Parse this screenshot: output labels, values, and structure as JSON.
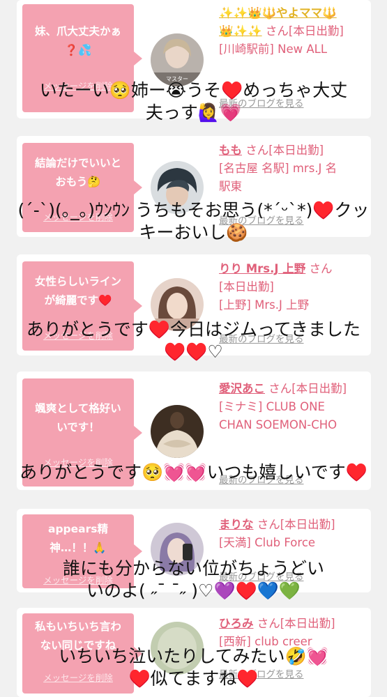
{
  "cards": [
    {
      "bubble_text": "妹、爪大丈夫かぁ\n❓💦",
      "delete_label": "メッセージを削除",
      "name": "✨✨👑🔱やよママ🔱\n👑✨✨",
      "san_text": "さん[本日出勤]",
      "location": "[川崎駅前] New ALL",
      "blog_link": "最新のブログを見る",
      "avatar_caption": "マスター",
      "overlay": "いたーい🥺姉ー😭うそ♥️めっちゃ大丈\n夫っす🙋‍♀️💗"
    },
    {
      "bubble_text": "結論だけでいいと\nおもう🤔",
      "delete_label": "メッセージを削除",
      "name": "もも",
      "san_text": "さん[本日出勤]",
      "location": "[名古屋 名駅] mrs.J 名\n駅東",
      "blog_link": "最新のブログを見る",
      "overlay": "(ˊ-ˋ)(｡_｡)ｳﾝｳﾝ うちもそお思う(*ˊᵕˋ*)♥️クッ\nキーおいし🍪"
    },
    {
      "bubble_text": "女性らしいライン\nが綺麗です♥️",
      "delete_label": "メッセージを削除",
      "name": "りり Mrs.J 上野",
      "san_text": "さん\n[本日出勤]",
      "location": "[上野] Mrs.J 上野",
      "blog_link": "最新のブログを見る",
      "overlay": "ありがとうです♥️今日はジムってきました\n♥️♥️♡"
    },
    {
      "bubble_text": "颯爽として格好い\nいです！",
      "delete_label": "メッセージを削除",
      "name": "愛沢あこ",
      "san_text": "さん[本日出勤]",
      "location": "[ミナミ] CLUB ONE\nCHAN SOEMON-CHO",
      "blog_link": "最新のブログを見る",
      "overlay": "ありがとうです🥺💓💓いつも嬉しいです♥️"
    },
    {
      "bubble_text": "appears精\n神…！！🙏",
      "delete_label": "メッセージを削除",
      "name": "まりな",
      "san_text": "さん[本日出勤]",
      "location": "[天満] Club Force",
      "blog_link": "最新のブログを見る",
      "overlay": "誰にも分からない位がちょうどい\nいのよ( ˶ˉ ˉ˶ )♡💜♥️💙💚"
    },
    {
      "bubble_text": "私もいちいち言わ\nない同じですね",
      "delete_label": "メッセージを削除",
      "name": "ひろみ",
      "san_text": "さん[本日出勤]",
      "location": "[西新] club creer",
      "blog_link": "最新のブログを見る",
      "overlay": "いちいち泣いたりしてみたい🤣💓\n♥️似てますね♥️"
    }
  ]
}
